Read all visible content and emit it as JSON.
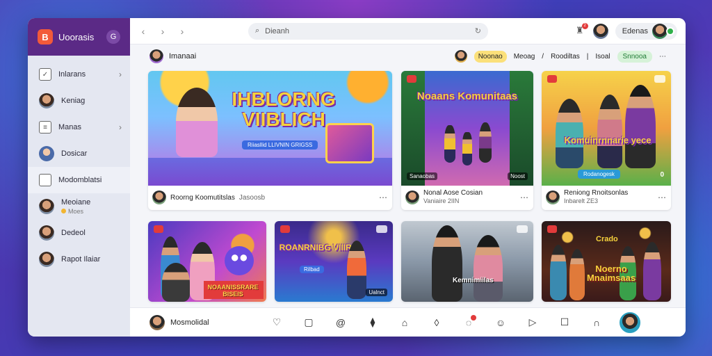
{
  "app": {
    "logo_letter": "B",
    "name": "Uoorasis",
    "toggle": "G"
  },
  "sidebar": {
    "items": [
      {
        "label": "Inlarans",
        "icon": "chat-icon",
        "chevron": true
      },
      {
        "label": "Keniag",
        "icon": "avatar"
      },
      {
        "label": "Manas",
        "icon": "document-icon",
        "chevron": true
      },
      {
        "label": "Dosicar",
        "icon": "avatar-blue"
      },
      {
        "label": "Modomblatsi",
        "icon": "square-icon"
      },
      {
        "label": "Meoiane",
        "sub": "Moes",
        "icon": "avatar"
      },
      {
        "label": "Dedeol",
        "icon": "avatar"
      },
      {
        "label": "Rapot Ilaiar",
        "icon": "avatar"
      }
    ]
  },
  "topbar": {
    "search_placeholder": "Dieanh",
    "notification_count": "2",
    "user_pill": "Edenas"
  },
  "channel": {
    "name": "Imanaai",
    "chips": [
      "Noonao",
      "Meoag",
      "Roodiltas",
      "Isoal",
      "Snnooa"
    ]
  },
  "cards": [
    {
      "title": "IHBLORNG VIIBLICH",
      "banner": "Riiasllid LLIVNIN GRIGSS",
      "channel": "Roorng Koomutitslas",
      "meta": "Jasoosb",
      "duration": ""
    },
    {
      "title": "Noaans Komunitaas",
      "channel": "Nonal Aose Cosian",
      "meta": "Vaniaire 2IIN",
      "duration": "",
      "caption": "Sanaobas",
      "dur_right": "Noost"
    },
    {
      "title": "Komuinrnnarie yece",
      "banner": "Rodanogesk",
      "channel": "Reniong Rnoitsonlas",
      "meta": "Inbarelt ZE3",
      "badge": "0"
    },
    {
      "title": "NOAANISSRARE BISEIS",
      "channel": "",
      "meta": ""
    },
    {
      "title": "ROANRNIBG VIIIRA",
      "sub": "Rilbad",
      "dur_right": "Ualnct"
    },
    {
      "title": "Kemnimiilas",
      "channel": "",
      "meta": ""
    },
    {
      "title": "Noerno Mnaimsaas",
      "top_text": "Crado"
    }
  ],
  "bottombar": {
    "username": "Mosmolidal",
    "icons": [
      "heart-chat-icon",
      "square-icon",
      "at-icon",
      "leaf-icon",
      "bell-icon",
      "leaf2-icon",
      "chat-badge-icon",
      "face-icon",
      "play-icon",
      "message-icon",
      "headset-icon"
    ]
  }
}
